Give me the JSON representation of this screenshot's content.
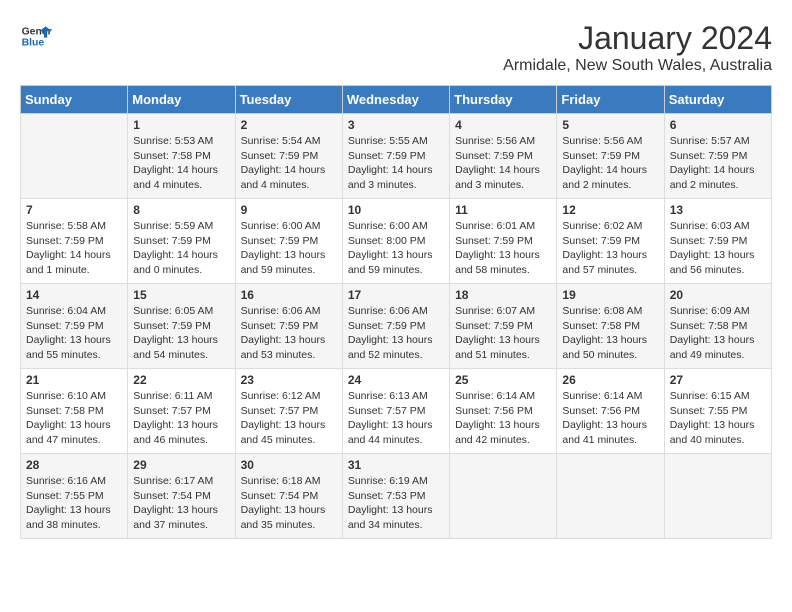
{
  "logo": {
    "line1": "General",
    "line2": "Blue"
  },
  "title": "January 2024",
  "subtitle": "Armidale, New South Wales, Australia",
  "headers": [
    "Sunday",
    "Monday",
    "Tuesday",
    "Wednesday",
    "Thursday",
    "Friday",
    "Saturday"
  ],
  "weeks": [
    [
      {
        "day": "",
        "info": ""
      },
      {
        "day": "1",
        "info": "Sunrise: 5:53 AM\nSunset: 7:58 PM\nDaylight: 14 hours\nand 4 minutes."
      },
      {
        "day": "2",
        "info": "Sunrise: 5:54 AM\nSunset: 7:59 PM\nDaylight: 14 hours\nand 4 minutes."
      },
      {
        "day": "3",
        "info": "Sunrise: 5:55 AM\nSunset: 7:59 PM\nDaylight: 14 hours\nand 3 minutes."
      },
      {
        "day": "4",
        "info": "Sunrise: 5:56 AM\nSunset: 7:59 PM\nDaylight: 14 hours\nand 3 minutes."
      },
      {
        "day": "5",
        "info": "Sunrise: 5:56 AM\nSunset: 7:59 PM\nDaylight: 14 hours\nand 2 minutes."
      },
      {
        "day": "6",
        "info": "Sunrise: 5:57 AM\nSunset: 7:59 PM\nDaylight: 14 hours\nand 2 minutes."
      }
    ],
    [
      {
        "day": "7",
        "info": "Sunrise: 5:58 AM\nSunset: 7:59 PM\nDaylight: 14 hours\nand 1 minute."
      },
      {
        "day": "8",
        "info": "Sunrise: 5:59 AM\nSunset: 7:59 PM\nDaylight: 14 hours\nand 0 minutes."
      },
      {
        "day": "9",
        "info": "Sunrise: 6:00 AM\nSunset: 7:59 PM\nDaylight: 13 hours\nand 59 minutes."
      },
      {
        "day": "10",
        "info": "Sunrise: 6:00 AM\nSunset: 8:00 PM\nDaylight: 13 hours\nand 59 minutes."
      },
      {
        "day": "11",
        "info": "Sunrise: 6:01 AM\nSunset: 7:59 PM\nDaylight: 13 hours\nand 58 minutes."
      },
      {
        "day": "12",
        "info": "Sunrise: 6:02 AM\nSunset: 7:59 PM\nDaylight: 13 hours\nand 57 minutes."
      },
      {
        "day": "13",
        "info": "Sunrise: 6:03 AM\nSunset: 7:59 PM\nDaylight: 13 hours\nand 56 minutes."
      }
    ],
    [
      {
        "day": "14",
        "info": "Sunrise: 6:04 AM\nSunset: 7:59 PM\nDaylight: 13 hours\nand 55 minutes."
      },
      {
        "day": "15",
        "info": "Sunrise: 6:05 AM\nSunset: 7:59 PM\nDaylight: 13 hours\nand 54 minutes."
      },
      {
        "day": "16",
        "info": "Sunrise: 6:06 AM\nSunset: 7:59 PM\nDaylight: 13 hours\nand 53 minutes."
      },
      {
        "day": "17",
        "info": "Sunrise: 6:06 AM\nSunset: 7:59 PM\nDaylight: 13 hours\nand 52 minutes."
      },
      {
        "day": "18",
        "info": "Sunrise: 6:07 AM\nSunset: 7:59 PM\nDaylight: 13 hours\nand 51 minutes."
      },
      {
        "day": "19",
        "info": "Sunrise: 6:08 AM\nSunset: 7:58 PM\nDaylight: 13 hours\nand 50 minutes."
      },
      {
        "day": "20",
        "info": "Sunrise: 6:09 AM\nSunset: 7:58 PM\nDaylight: 13 hours\nand 49 minutes."
      }
    ],
    [
      {
        "day": "21",
        "info": "Sunrise: 6:10 AM\nSunset: 7:58 PM\nDaylight: 13 hours\nand 47 minutes."
      },
      {
        "day": "22",
        "info": "Sunrise: 6:11 AM\nSunset: 7:57 PM\nDaylight: 13 hours\nand 46 minutes."
      },
      {
        "day": "23",
        "info": "Sunrise: 6:12 AM\nSunset: 7:57 PM\nDaylight: 13 hours\nand 45 minutes."
      },
      {
        "day": "24",
        "info": "Sunrise: 6:13 AM\nSunset: 7:57 PM\nDaylight: 13 hours\nand 44 minutes."
      },
      {
        "day": "25",
        "info": "Sunrise: 6:14 AM\nSunset: 7:56 PM\nDaylight: 13 hours\nand 42 minutes."
      },
      {
        "day": "26",
        "info": "Sunrise: 6:14 AM\nSunset: 7:56 PM\nDaylight: 13 hours\nand 41 minutes."
      },
      {
        "day": "27",
        "info": "Sunrise: 6:15 AM\nSunset: 7:55 PM\nDaylight: 13 hours\nand 40 minutes."
      }
    ],
    [
      {
        "day": "28",
        "info": "Sunrise: 6:16 AM\nSunset: 7:55 PM\nDaylight: 13 hours\nand 38 minutes."
      },
      {
        "day": "29",
        "info": "Sunrise: 6:17 AM\nSunset: 7:54 PM\nDaylight: 13 hours\nand 37 minutes."
      },
      {
        "day": "30",
        "info": "Sunrise: 6:18 AM\nSunset: 7:54 PM\nDaylight: 13 hours\nand 35 minutes."
      },
      {
        "day": "31",
        "info": "Sunrise: 6:19 AM\nSunset: 7:53 PM\nDaylight: 13 hours\nand 34 minutes."
      },
      {
        "day": "",
        "info": ""
      },
      {
        "day": "",
        "info": ""
      },
      {
        "day": "",
        "info": ""
      }
    ]
  ]
}
